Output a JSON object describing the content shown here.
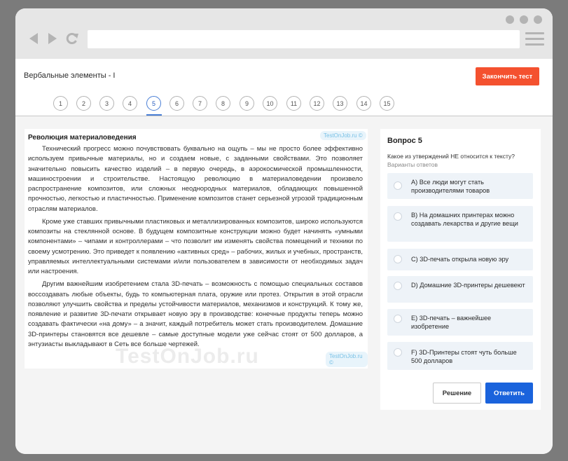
{
  "header": {
    "test_title": "Вербальные элементы - I",
    "finish_label": "Закончить тест"
  },
  "question_nav": {
    "items": [
      "1",
      "2",
      "3",
      "4",
      "5",
      "6",
      "7",
      "8",
      "9",
      "10",
      "11",
      "12",
      "13",
      "14",
      "15"
    ],
    "active": "5"
  },
  "article": {
    "title": "Революция материаловедения",
    "paragraphs": [
      "Технический прогресс можно почувствовать буквально на ощупь – мы не просто более эффективно используем привычные материалы, но и создаем новые, с заданными свойствами. Это позволяет значительно повысить качество изделий – в первую очередь, в аэрокосмической промышленности, машиностроении и строительстве. Настоящую революцию в материаловедении произвело распространение композитов, или сложных неоднородных материалов, обладающих повышенной прочностью, легкостью и пластичностью. Применение композитов станет серьезной угрозой традиционным отраслям материалов.",
      "Кроме уже ставших привычными пластиковых и металлизированных композитов, широко используются композиты на стеклянной основе. В будущем композитные конструкции можно будет начинять «умными компонентами» – чипами и контроллерами – что позволит им изменять свойства помещений и техники по своему усмотрению. Это приведет к появлению «активных сред» – рабочих, жилых и учебных, пространств, управляемых интеллектуальными системами и/или пользователем в зависимости от необходимых задач или настроения.",
      "Другим важнейшим изобретением стала 3D-печать – возможность с помощью специальных составов воссоздавать любые объекты, будь то компьютерная плата, оружие или протез. Открытия в этой отрасли позволяют улучшить свойства и пределы устойчивости материалов, механизмов и конструкций. К тому же, появление и развитие 3D-печати открывает новую эру в производстве: конечные продукты теперь можно создавать фактически «на дому» – а значит, каждый потребитель может стать производителем. Домашние 3D-принтеры становятся все дешевле – самые доступные модели уже сейчас стоят от 500 долларов, а энтузиасты выкладывают в Сеть все больше чертежей."
    ],
    "watermark_badge": "TestOnJob.ru ©",
    "watermark_large": "TestOnJob.ru"
  },
  "question": {
    "title": "Вопрос 5",
    "text": "Какое из утверждений НЕ относится к тексту?",
    "subtitle": "Варианты ответов",
    "options": [
      "A) Все люди могут стать производителями товаров",
      "B) На домашних принтерах можно создавать лекарства и другие вещи",
      "C) 3D-печать открыла новую эру",
      "D) Домашние 3D-принтеры дешевеют",
      "E) 3D-печать – важнейшее изобретение",
      "F) 3D-Принтеры стоят чуть больше 500 долларов"
    ],
    "solution_label": "Решение",
    "answer_label": "Ответить"
  },
  "colors": {
    "accent_blue": "#1a63dc",
    "finish_red": "#f4512f",
    "option_bg": "#eef3f8"
  }
}
